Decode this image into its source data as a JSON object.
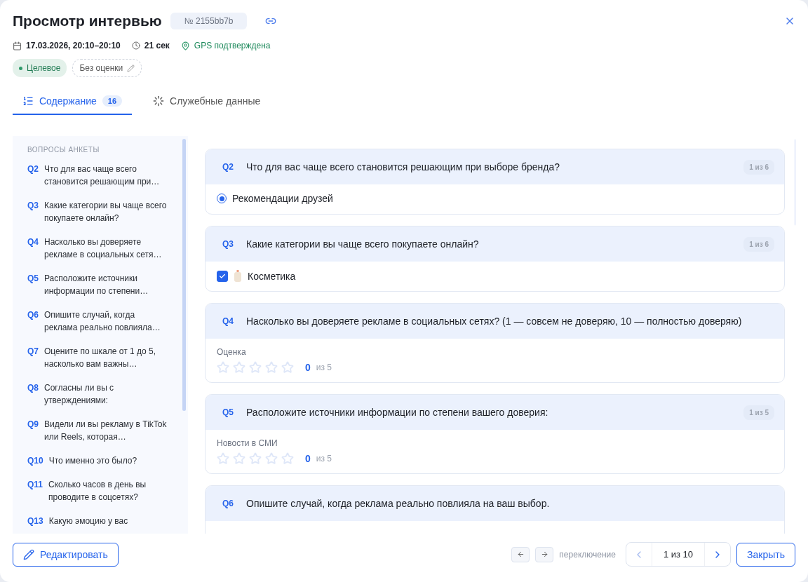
{
  "title": "Просмотр интервью",
  "interview_id": "№ 2155bb7b",
  "meta": {
    "date": "17.03.2026, 20:10–20:10",
    "duration": "21 сек",
    "gps": "GPS подтверждена"
  },
  "tags": [
    {
      "kind": "status",
      "label": "Целевое",
      "color": "#2e9a6a"
    },
    {
      "kind": "editable",
      "label": "Без оценки"
    }
  ],
  "tabs": [
    {
      "label": "Содержание",
      "count": "16",
      "selected": true
    },
    {
      "label": "Служебные данные",
      "selected": false
    }
  ],
  "sidebar": {
    "heading": "ВОПРОСЫ АНКЕТЫ",
    "items": [
      {
        "code": "Q2",
        "text": "Что для вас чаще всего становится решающим при…"
      },
      {
        "code": "Q3",
        "text": "Какие категории вы чаще всего покупаете онлайн?"
      },
      {
        "code": "Q4",
        "text": "Насколько вы доверяете рекламе в социальных сетя…"
      },
      {
        "code": "Q5",
        "text": "Расположите источники информации по степени…"
      },
      {
        "code": "Q6",
        "text": "Опишите случай, когда реклама реально повлияла…"
      },
      {
        "code": "Q7",
        "text": "Оцените по шкале от 1 до 5, насколько вам важны…"
      },
      {
        "code": "Q8",
        "text": "Согласны ли вы с утверждениями:"
      },
      {
        "code": "Q9",
        "text": "Видели ли вы рекламу в TikTok или Reels, которая…"
      },
      {
        "code": "Q10",
        "text": "Что именно это было?"
      },
      {
        "code": "Q11",
        "text": "Сколько часов в день вы проводите в соцсетях?"
      },
      {
        "code": "Q13",
        "text": "Какую эмоцию у вас"
      }
    ]
  },
  "questions": [
    {
      "code": "Q2",
      "text": "Что для вас чаще всего становится решающим при выборе бренда?",
      "counter": "1 из 6",
      "kind": "radio",
      "answer": {
        "label": "Рекомендации друзей",
        "selected": true
      }
    },
    {
      "code": "Q3",
      "text": "Какие категории вы чаще всего покупаете онлайн?",
      "counter": "1 из 6",
      "kind": "checkbox",
      "answer": {
        "label": "Косметика",
        "checked": true
      }
    },
    {
      "code": "Q4",
      "text": "Насколько вы доверяете рекламе в социальных сетях? (1 — совсем не доверяю, 10 — полностью доверяю)",
      "kind": "rating",
      "answer": {
        "label": "Оценка",
        "stars": 0,
        "value": "0",
        "scale": "из 5"
      }
    },
    {
      "code": "Q5",
      "text": "Расположите источники информации по степени вашего доверия:",
      "counter": "1 из 5",
      "kind": "rating",
      "answer": {
        "label": "Новости в СМИ",
        "stars": 0,
        "value": "0",
        "scale": "из 5"
      }
    },
    {
      "code": "Q6",
      "text": "Опишите случай, когда реклама реально повлияла на ваш выбор.",
      "kind": "text"
    }
  ],
  "footer": {
    "edit": "Редактировать",
    "hint": "переключение",
    "pager": "1 из 10",
    "close": "Закрыть"
  }
}
